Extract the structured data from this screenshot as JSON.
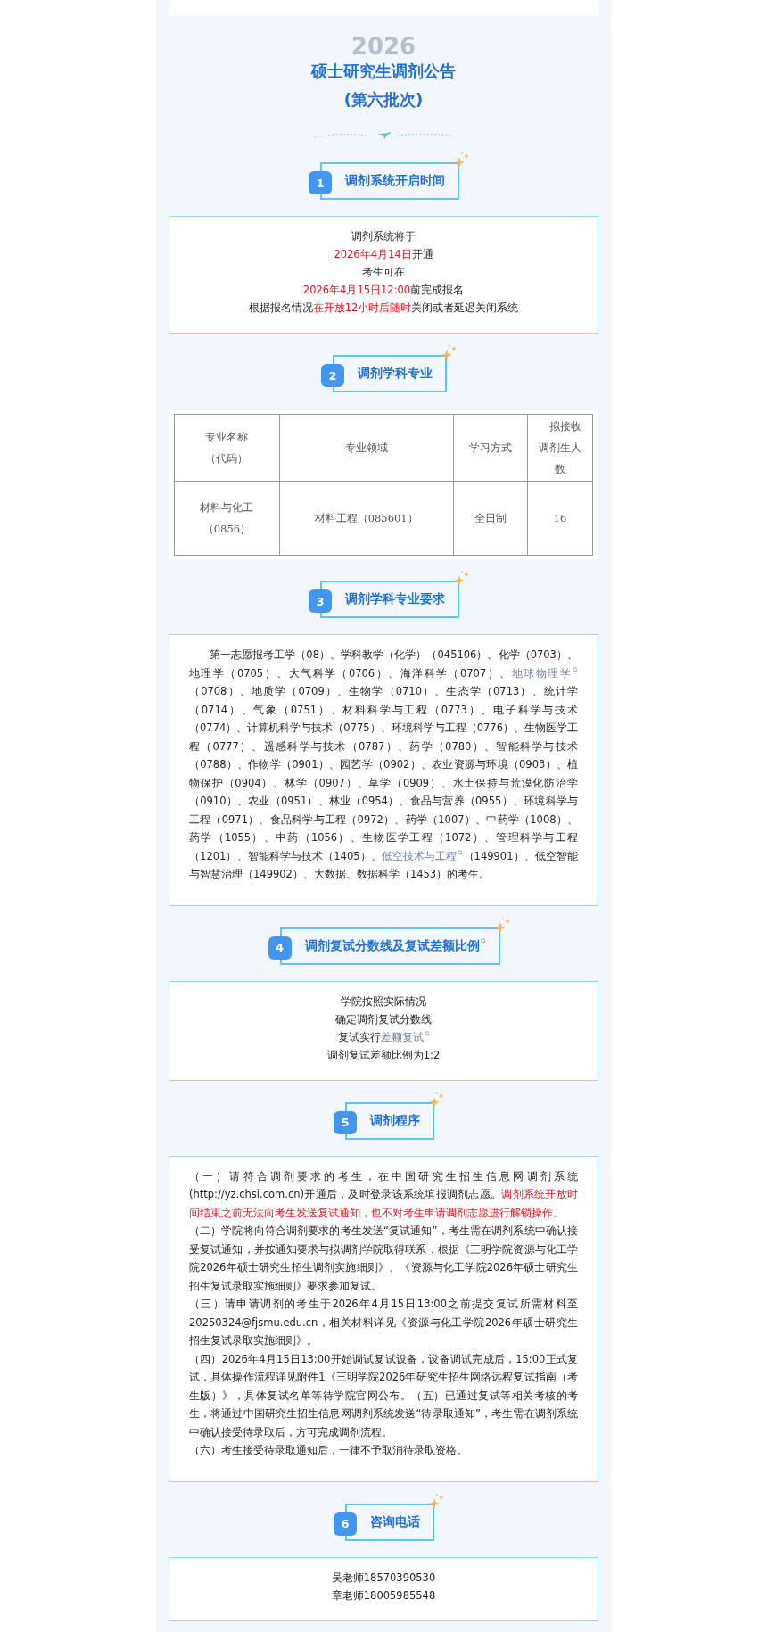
{
  "title": {
    "backdrop": "2026",
    "lines": [
      "硕士研究生调剂公告",
      "(第六批次)"
    ]
  },
  "sections": [
    {
      "number": "1",
      "heading": "调剂系统开启时间",
      "search_mark": false,
      "kind": "centered",
      "lines": [
        [
          {
            "kind": "plain",
            "text": "调剂系统将于"
          }
        ],
        [
          {
            "kind": "red",
            "text": "2026年4月14日"
          },
          {
            "kind": "plain",
            "text": "开通"
          }
        ],
        [
          {
            "kind": "plain",
            "text": "考生可在"
          }
        ],
        [
          {
            "kind": "red",
            "text": "2026年4月15日12:00"
          },
          {
            "kind": "plain",
            "text": "前完成报名"
          }
        ],
        [
          {
            "kind": "plain",
            "text": "根据报名情况"
          },
          {
            "kind": "red",
            "text": "在开放12小时后随时"
          },
          {
            "kind": "plain",
            "text": "关闭或者延迟关闭系统"
          }
        ]
      ]
    },
    {
      "number": "2",
      "heading": "调剂学科专业",
      "search_mark": false,
      "kind": "table",
      "table": {
        "columns": [
          "专业名称（代码）",
          "专业领域",
          "学习方式",
          "拟接收调剂生人数"
        ],
        "rows": [
          [
            "材料与化工（0856）",
            "材料工程（085601）",
            "全日制",
            "16"
          ]
        ]
      }
    },
    {
      "number": "3",
      "heading": "调剂学科专业要求",
      "search_mark": false,
      "kind": "paragraphs",
      "paragraphs": [
        [
          {
            "kind": "plain",
            "text": "第一志愿报考工学（08）、学科教学（化学）（045106）、化学（0703）、地理学（0705）、大气科学（0706）、海洋科学（0707）、"
          },
          {
            "kind": "link",
            "text": "地球物理学"
          },
          {
            "kind": "plain",
            "text": "（0708）、地质学（0709）、生物学（0710）、生态学（0713）、统计学（0714）、气象（0751）、材料科学与工程（0773）、电子科学与技术（0774）、计算机科学与技术（0775）、环境科学与工程（0776）、生物医学工程（0777）、遥感科学与技术（0787）、药学（0780）、智能科学与技术（0788）、作物学（0901）、园艺学（0902）、农业资源与环境（0903）、植物保护（0904）、林学（0907）、草学（0909）、水土保持与荒漠化防治学（0910）、农业（0951）、林业（0954）、食品与营养（0955）、环境科学与工程（0971）、食品科学与工程（0972）、药学（1007）、中药学（1008）、药学（1055）、中药（1056）、生物医学工程（1072）、管理科学与工程（1201）、智能科学与技术（1405）、"
          },
          {
            "kind": "link",
            "text": "低空技术与工程"
          },
          {
            "kind": "plain",
            "text": "（149901）、低空智能与智慧治理（149902）、大数据、数据科学（1453）的考生。"
          }
        ]
      ]
    },
    {
      "number": "4",
      "heading": "调剂复试分数线及复试差额比例",
      "search_mark": true,
      "kind": "centered",
      "lines": [
        [
          {
            "kind": "plain",
            "text": "学院按照实际情况"
          }
        ],
        [
          {
            "kind": "plain",
            "text": "确定调剂复试分数线"
          }
        ],
        [
          {
            "kind": "plain",
            "text": "复试实行"
          },
          {
            "kind": "link",
            "text": "差额复试"
          }
        ],
        [
          {
            "kind": "plain",
            "text": "调剂复试差额比例为1:2"
          }
        ]
      ]
    },
    {
      "number": "5",
      "heading": "调剂程序",
      "search_mark": false,
      "kind": "paragraphs",
      "paragraphs": [
        [
          {
            "kind": "plain",
            "text": "（一）请符合调剂要求的考生，在中国研究生招生信息网调剂系统(http://yz.chsi.com.cn)开通后，及时登录该系统填报调剂志愿。"
          },
          {
            "kind": "red",
            "text": "调剂系统开放时间结束之前无法向考生发送复试通知，也不对考生申请调剂志愿进行解锁操作。"
          }
        ],
        [
          {
            "kind": "plain",
            "text": "（二）学院将向符合调剂要求的考生发送“复试通知”，考生需在调剂系统中确认接受复试通知，并按通知要求与拟调剂学院取得联系，根据《三明学院资源与化工学院2026年硕士研究生招生调剂实施细则》、《资源与化工学院2026年硕士研究生招生复试录取实施细则》要求参加复试。"
          }
        ],
        [
          {
            "kind": "plain",
            "text": "（三）请申请调剂的考生于2026年4月15日13:00之前提交复试所需材料至20250324@fjsmu.edu.cn，相关材料详见《资源与化工学院2026年硕士研究生招生复试录取实施细则》。"
          }
        ],
        [
          {
            "kind": "plain",
            "text": "（四）2026年4月15日13:00开始调试复试设备，设备调试完成后，15:00正式复试，具体操作流程详见附件1《三明学院2026年研究生招生网络远程复试指南（考生版）》，具体复试名单等待学院官网公布。（五）已通过复试等相关考核的考生，将通过中国研究生招生信息网调剂系统发送“待录取通知”，考生需在调剂系统中确认接受待录取后，方可完成调剂流程。"
          }
        ],
        [
          {
            "kind": "plain",
            "text": "（六）考生接受待录取通知后，一律不予取消待录取资格。"
          }
        ]
      ]
    },
    {
      "number": "6",
      "heading": "咨询电话",
      "search_mark": false,
      "kind": "centered",
      "lines": [
        [
          {
            "kind": "plain",
            "text": "吴老师18570390530"
          }
        ],
        [
          {
            "kind": "plain",
            "text": "章老师18005985548"
          }
        ]
      ]
    }
  ]
}
